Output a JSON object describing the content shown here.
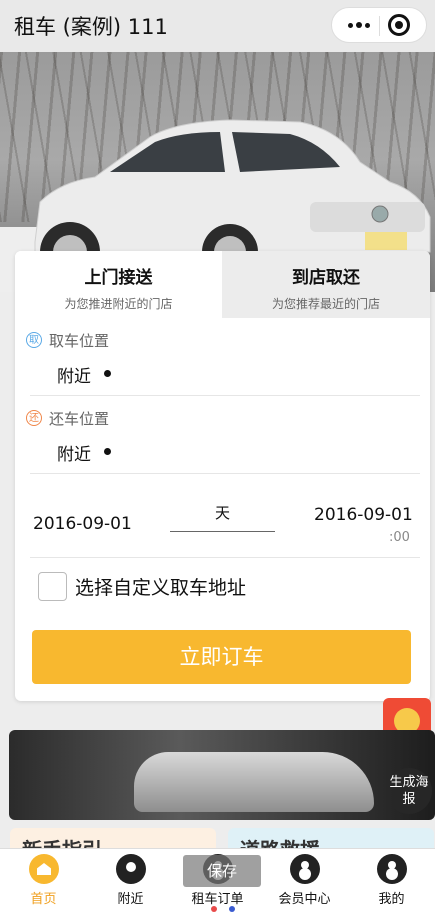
{
  "nav": {
    "title": "租车 (案例) 111"
  },
  "tabs": [
    {
      "title": "上门接送",
      "subtitle": "为您推进附近的门店"
    },
    {
      "title": "到店取还",
      "subtitle": "为您推荐最近的门店"
    }
  ],
  "pickup": {
    "badge": "取",
    "label": "取车位置",
    "value": "附近"
  },
  "return": {
    "badge": "还",
    "label": "还车位置",
    "value": "附近"
  },
  "dates": {
    "start": "2016-09-01",
    "days_label": "天",
    "end": "2016-09-01",
    "end_time": ":00"
  },
  "custom_address": {
    "label": "选择自定义取车地址",
    "checked": false
  },
  "book_button": "立即订车",
  "poster_button": "生成海报",
  "peek": {
    "left": "新手指引",
    "right": "道路救援"
  },
  "tabbar": [
    {
      "label": "首页",
      "icon": "home-icon",
      "active": true
    },
    {
      "label": "附近",
      "icon": "location-icon",
      "active": false
    },
    {
      "label": "租车订单",
      "icon": "order-icon",
      "active": false
    },
    {
      "label": "会员中心",
      "icon": "member-icon",
      "active": false
    },
    {
      "label": "我的",
      "icon": "profile-icon",
      "active": false
    }
  ],
  "save_tip": "保存",
  "colors": {
    "accent": "#f8b82f",
    "active_tab": "#f0a020"
  }
}
